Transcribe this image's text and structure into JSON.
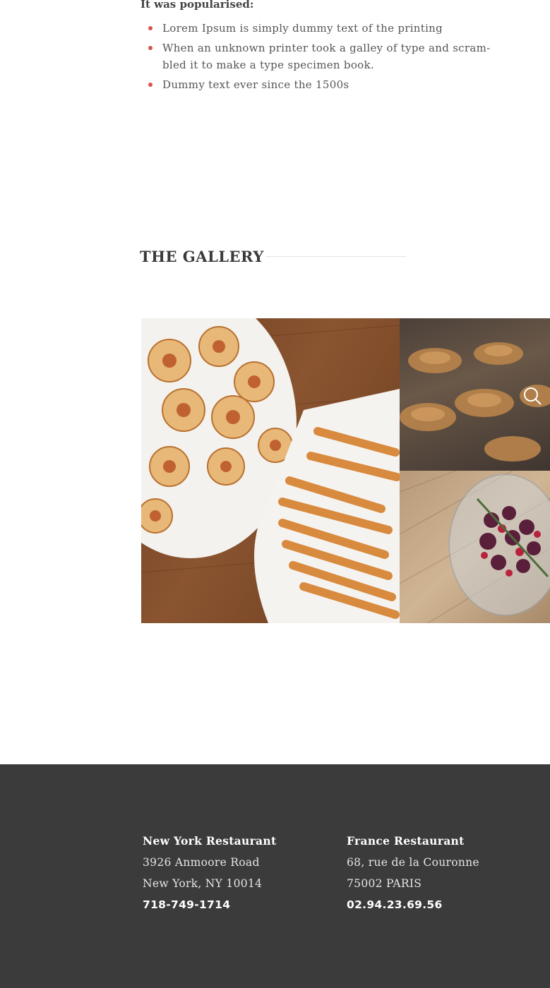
{
  "intro": {
    "title": "It was popularised:",
    "bullets": [
      "Lorem Ipsum is simply dummy text of the printing",
      "When an unknown printer took a galley of type and scram-bled it to make a type specimen book.",
      "Dummy text ever since the 1500s"
    ],
    "bullet_color": "#d9534f"
  },
  "gallery": {
    "title": "THE GALLERY",
    "images": [
      {
        "alt": "pastries-on-plate"
      },
      {
        "alt": "croissants"
      },
      {
        "alt": "berries-bowl"
      }
    ],
    "icon": "search-icon"
  },
  "footer": {
    "background": "#3b3b3c",
    "locations": [
      {
        "name": "New York Restaurant",
        "line1": "3926 Anmoore Road",
        "line2": "New York, NY 10014",
        "phone": "718-749-1714"
      },
      {
        "name": "France Restaurant",
        "line1": "68, rue  de la Couronne",
        "line2": "75002 PARIS",
        "phone": "02.94.23.69.56"
      }
    ]
  }
}
